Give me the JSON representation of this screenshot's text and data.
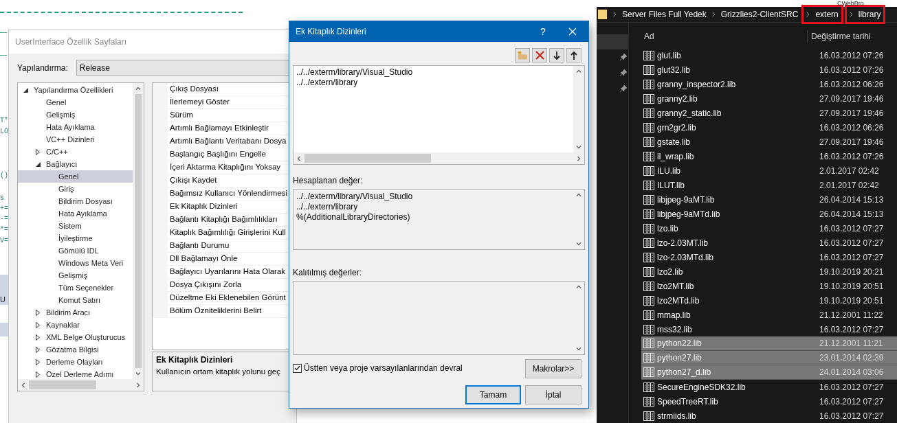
{
  "editor": {
    "code_fragments": [
      "T*",
      "LO",
      "()",
      "s",
      "+=",
      "-=",
      "*=",
      "V="
    ],
    "tab_label": "U",
    "corner_label": "CWebBro"
  },
  "property_window": {
    "title": "UserInterface Özellik Sayfaları",
    "configuration_label": "Yapılandırma:",
    "configuration_value": "Release",
    "tree": [
      {
        "label": "Yapılandırma Özellikleri",
        "expanded": true,
        "selected": false,
        "children": [
          {
            "label": "Genel",
            "selected": false
          },
          {
            "label": "Gelişmiş",
            "selected": false
          },
          {
            "label": "Hata Ayıklama",
            "selected": false
          },
          {
            "label": "VC++ Dizinleri",
            "selected": false
          },
          {
            "label": "C/C++",
            "expanded": false,
            "selected": false
          },
          {
            "label": "Bağlayıcı",
            "expanded": true,
            "selected": false,
            "children": [
              {
                "label": "Genel",
                "selected": true
              },
              {
                "label": "Giriş",
                "selected": false
              },
              {
                "label": "Bildirim Dosyası",
                "selected": false
              },
              {
                "label": "Hata Ayıklama",
                "selected": false
              },
              {
                "label": "Sistem",
                "selected": false
              },
              {
                "label": "İyileştirme",
                "selected": false
              },
              {
                "label": "Gömülü IDL",
                "selected": false
              },
              {
                "label": "Windows Meta Veri",
                "selected": false
              },
              {
                "label": "Gelişmiş",
                "selected": false
              },
              {
                "label": "Tüm Seçenekler",
                "selected": false
              },
              {
                "label": "Komut Satırı",
                "selected": false
              }
            ]
          },
          {
            "label": "Bildirim Aracı",
            "expanded": false,
            "selected": false
          },
          {
            "label": "Kaynaklar",
            "expanded": false,
            "selected": false
          },
          {
            "label": "XML Belge Oluşturucus",
            "expanded": false,
            "selected": false
          },
          {
            "label": "Gözatma Bilgisi",
            "expanded": false,
            "selected": false
          },
          {
            "label": "Derleme Olayları",
            "expanded": false,
            "selected": false
          },
          {
            "label": "Özel Derleme Adımı",
            "expanded": false,
            "selected": false
          }
        ]
      }
    ],
    "properties": [
      "Çıkış Dosyası",
      "İlerlemeyi Göster",
      "Sürüm",
      "Artımlı Bağlamayı Etkinleştir",
      "Artımlı Bağlantı Veritabanı Dosya",
      "Başlangıç Başlığını Engelle",
      "İçeri Aktarma Kitaplığını Yoksay",
      "Çıkışı Kaydet",
      "Bağımsız Kullanıcı Yönlendirmesi",
      "Ek Kitaplık Dizinleri",
      "Bağlantı Kitaplığı Bağımlılıkları",
      "Kitaplık Bağımlılığı Girişlerini Kull",
      "Bağlantı Durumu",
      "Dll Bağlamayı Önle",
      "Bağlayıcı Uyarılarını Hata Olarak",
      "Dosya Çıkışını Zorla",
      "Düzeltme Eki Eklenebilen Görünt",
      "Bölüm Özniteliklerini Belirt"
    ],
    "description": {
      "title": "Ek Kitaplık Dizinleri",
      "text": "Kullanıcın ortam kitaplık yolunu geç"
    }
  },
  "dialog": {
    "title": "Ek Kitaplık Dizinleri",
    "help": "?",
    "directories": [
      "../../exterm/library/Visual_Studio",
      "../../extern/library"
    ],
    "computed_label": "Hesaplanan değer:",
    "computed_values": [
      "../../exterm/library/Visual_Studio",
      "../../extern/library",
      "%(AdditionalLibraryDirectories)"
    ],
    "inherited_label": "Kalıtılmış değerler:",
    "inherit": {
      "label": "Üstten veya proje varsayılanlarından devral",
      "checked": true
    },
    "macros_button": "Makrolar>>",
    "ok_button": "Tamam",
    "cancel_button": "İptal"
  },
  "explorer": {
    "breadcrumb": [
      {
        "label": "Server Files Full Yedek",
        "highlighted": false
      },
      {
        "label": "Grizzlies2-ClientSRC",
        "highlighted": false
      },
      {
        "label": "extern",
        "highlighted": true
      },
      {
        "label": "library",
        "highlighted": true
      }
    ],
    "columns": [
      "Ad",
      "Değiştirme tarihi"
    ],
    "files": [
      {
        "name": "glut.lib",
        "date": "16.03.2012 07:26",
        "selected": false
      },
      {
        "name": "glut32.lib",
        "date": "16.03.2012 07:26",
        "selected": false
      },
      {
        "name": "granny_inspector2.lib",
        "date": "16.03.2012 06:26",
        "selected": false
      },
      {
        "name": "granny2.lib",
        "date": "27.09.2017 19:46",
        "selected": false
      },
      {
        "name": "granny2_static.lib",
        "date": "27.09.2017 19:46",
        "selected": false
      },
      {
        "name": "grn2gr2.lib",
        "date": "16.03.2012 06:26",
        "selected": false
      },
      {
        "name": "gstate.lib",
        "date": "27.09.2017 19:46",
        "selected": false
      },
      {
        "name": "il_wrap.lib",
        "date": "16.03.2012 07:26",
        "selected": false
      },
      {
        "name": "ILU.lib",
        "date": "2.01.2017 02:42",
        "selected": false
      },
      {
        "name": "ILUT.lib",
        "date": "2.01.2017 02:42",
        "selected": false
      },
      {
        "name": "libjpeg-9aMT.lib",
        "date": "26.04.2014 15:13",
        "selected": false
      },
      {
        "name": "libjpeg-9aMTd.lib",
        "date": "26.04.2014 15:13",
        "selected": false
      },
      {
        "name": "lzo.lib",
        "date": "16.03.2012 07:27",
        "selected": false
      },
      {
        "name": "lzo-2.03MT.lib",
        "date": "16.03.2012 07:27",
        "selected": false
      },
      {
        "name": "lzo-2.03MTd.lib",
        "date": "16.03.2012 07:27",
        "selected": false
      },
      {
        "name": "lzo2.lib",
        "date": "19.10.2019 20:21",
        "selected": false
      },
      {
        "name": "lzo2MT.lib",
        "date": "19.10.2019 20:51",
        "selected": false
      },
      {
        "name": "lzo2MTd.lib",
        "date": "19.10.2019 20:51",
        "selected": false
      },
      {
        "name": "mmap.lib",
        "date": "21.12.2001 11:22",
        "selected": false
      },
      {
        "name": "mss32.lib",
        "date": "16.03.2012 07:27",
        "selected": false
      },
      {
        "name": "python22.lib",
        "date": "21.12.2001 11:21",
        "selected": true
      },
      {
        "name": "python27.lib",
        "date": "23.01.2014 02:39",
        "selected": true
      },
      {
        "name": "python27_d.lib",
        "date": "24.01.2014 03:06",
        "selected": true
      },
      {
        "name": "SecureEngineSDK32.lib",
        "date": "16.03.2012 07:27",
        "selected": false
      },
      {
        "name": "SpeedTreeRT.lib",
        "date": "16.03.2012 07:27",
        "selected": false
      },
      {
        "name": "strmiids.lib",
        "date": "16.03.2012 07:27",
        "selected": false
      }
    ]
  }
}
